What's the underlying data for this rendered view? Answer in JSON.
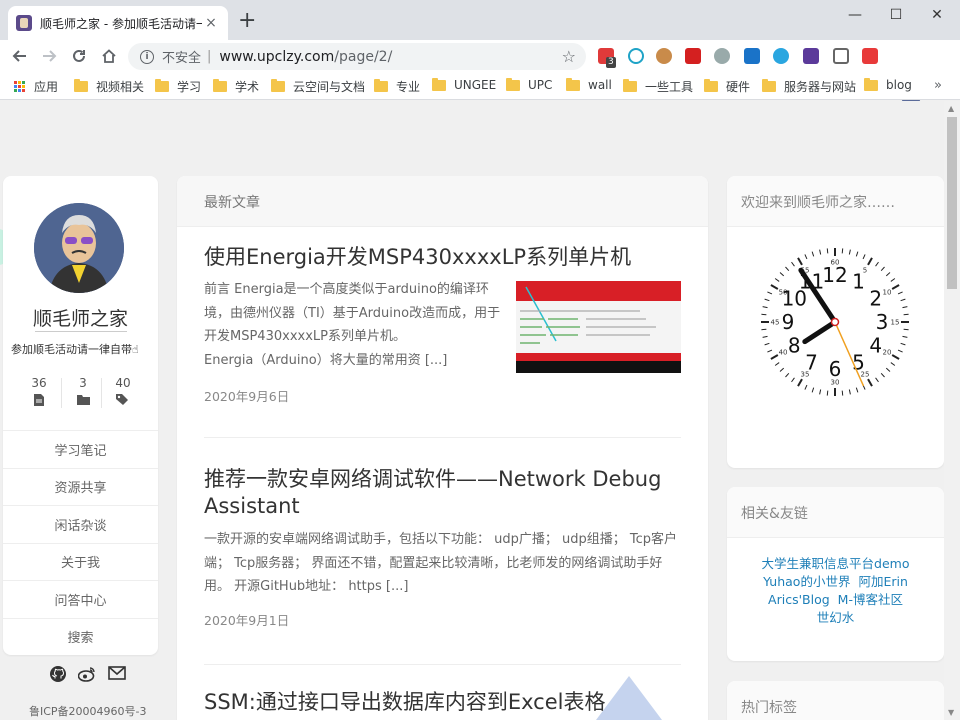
{
  "browser": {
    "tab_title": "顺毛师之家 - 参加顺毛活动请一律自带",
    "tab_close": "×",
    "new_tab": "+",
    "window_controls": {
      "minimize": "—",
      "maximize": "☐",
      "close": "✕"
    },
    "omnibox": {
      "insecure_label": "不安全",
      "separator": "|",
      "url_host": "www.upclzy.com",
      "url_path": "/page/2/"
    },
    "extension_badge": "3"
  },
  "bookmarks": [
    {
      "label": "应用",
      "icon": "apps-icon"
    },
    {
      "label": "视频相关",
      "icon": "folder-icon"
    },
    {
      "label": "学习",
      "icon": "folder-icon"
    },
    {
      "label": "学术",
      "icon": "folder-icon"
    },
    {
      "label": "云空间与文档",
      "icon": "folder-icon"
    },
    {
      "label": "专业",
      "icon": "folder-icon"
    },
    {
      "label": "UNGEE",
      "icon": "folder-icon"
    },
    {
      "label": "UPC",
      "icon": "folder-icon"
    },
    {
      "label": "wall",
      "icon": "folder-icon"
    },
    {
      "label": "一些工具",
      "icon": "folder-icon"
    },
    {
      "label": "硬件",
      "icon": "folder-icon"
    },
    {
      "label": "服务器与网站",
      "icon": "folder-icon"
    },
    {
      "label": "blog",
      "icon": "folder-icon"
    }
  ],
  "bookmarks_more": "»",
  "sidebar": {
    "site_name": "顺毛师之家",
    "tagline": "参加顺毛活动请一律自带",
    "stats": [
      {
        "count": "36",
        "icon": "file-icon"
      },
      {
        "count": "3",
        "icon": "folder-icon"
      },
      {
        "count": "40",
        "icon": "tags-icon"
      }
    ],
    "nav": [
      "学习笔记",
      "资源共享",
      "闲话杂谈",
      "关于我",
      "问答中心",
      "搜索"
    ],
    "social": [
      "github-icon",
      "weibo-icon",
      "mail-icon"
    ],
    "icp": "鲁ICP备20004960号-3"
  },
  "main": {
    "section_title": "最新文章",
    "posts": [
      {
        "title": "使用Energia开发MSP430xxxxLP系列单片机",
        "excerpt": "前言 Energia是一个高度类似于arduino的编译环境，由德州仪器（TI）基于Arduino改造而成，用于开发MSP430xxxxLP系列单片机。",
        "excerpt2": "Energia（Arduino）将大量的常用资 [...]",
        "date": "2020年9月6日"
      },
      {
        "title": "推荐一款安卓网络调试软件——Network Debug Assistant",
        "excerpt": "一款开源的安卓端网络调试助手，包括以下功能： udp广播； udp组播； Tcp客户端； Tcp服务器； 界面还不错，配置起来比较清晰，比老师发的网络调试助手好用。 开源GitHub地址： https [...]",
        "date": "2020年9月1日"
      },
      {
        "title": "SSM:通过接口导出数据库内容到Excel表格"
      }
    ]
  },
  "widgets": {
    "welcome_title": "欢迎来到顺毛师之家……",
    "clock": {
      "hour_numbers": [
        "12",
        "1",
        "2",
        "3",
        "4",
        "5",
        "6",
        "7",
        "8",
        "9",
        "10",
        "11"
      ],
      "minute_numbers": [
        "60",
        "5",
        "10",
        "15",
        "20",
        "25",
        "30",
        "35",
        "40",
        "45",
        "50",
        "55"
      ],
      "time": {
        "hour": 7,
        "minute": 54,
        "second": 26
      },
      "colors": {
        "hands": "#111111",
        "second_hand": "#f0a020",
        "center": "#d02020"
      }
    },
    "friends_title": "相关&友链",
    "friend_links": [
      "大学生兼职信息平台demo",
      "Yuhao的小世界",
      "阿加Erin",
      "Arics'Blog",
      "M-博客社区",
      "世幻水"
    ],
    "tags_title": "热门标签"
  },
  "colors": {
    "link": "#1e7fb8",
    "chrome_bg": "#dee1e6",
    "page_bg": "#f0f0f0"
  }
}
